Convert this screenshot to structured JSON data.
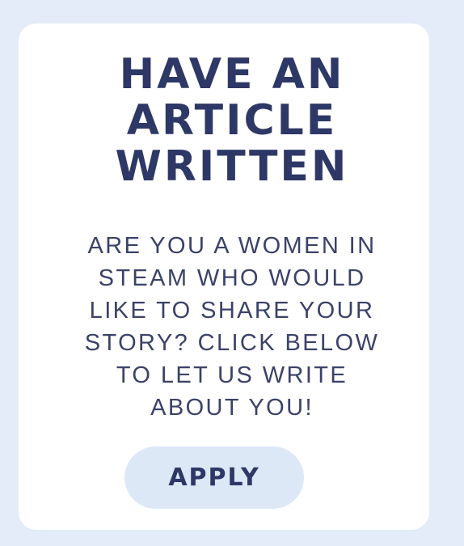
{
  "card": {
    "heading_lines": [
      "HAVE AN",
      "ARTICLE",
      "WRITTEN"
    ],
    "body_lines": [
      "ARE YOU A WOMEN IN",
      "STEAM WHO WOULD",
      "LIKE TO SHARE YOUR",
      "STORY? CLICK BELOW",
      "TO LET US WRITE",
      "ABOUT YOU!"
    ],
    "button_label": "APPLY"
  },
  "colors": {
    "page_background": "#e3ecf8",
    "card_background": "#ffffff",
    "heading_text": "#2e3866",
    "body_text": "#3b4268",
    "button_background": "#dde8f7"
  }
}
